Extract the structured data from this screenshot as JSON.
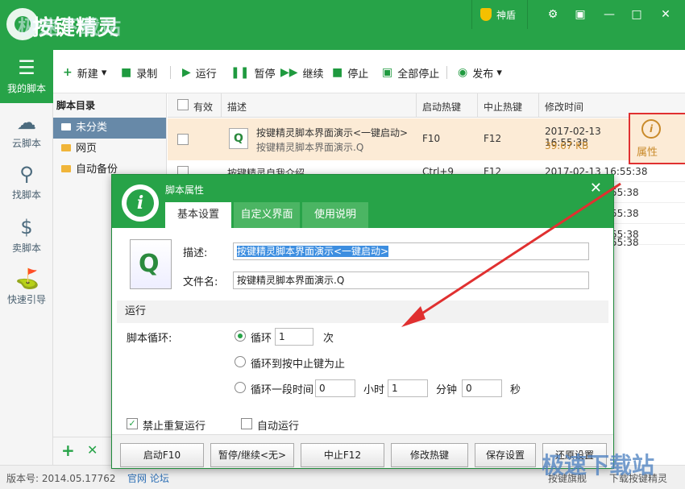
{
  "app": {
    "title": "按键精灵",
    "watermark_top": "极速下载站",
    "shield_label": "神盾"
  },
  "window_controls": {
    "settings": "⚙",
    "skin": "▣",
    "minimize": "—",
    "maximize": "□",
    "close": "✕"
  },
  "leftnav": [
    {
      "label": "我的脚本",
      "icon": "list-icon"
    },
    {
      "label": "云脚本",
      "icon": "cloud-icon"
    },
    {
      "label": "找脚本",
      "icon": "search-icon"
    },
    {
      "label": "卖脚本",
      "icon": "dollar-icon"
    },
    {
      "label": "快速引导",
      "icon": "signpost-icon"
    }
  ],
  "toolbar": {
    "new": "新建",
    "record": "录制",
    "run": "运行",
    "pause": "暂停",
    "resume": "继续",
    "stop": "停止",
    "stop_all": "全部停止",
    "publish": "发布"
  },
  "tree": {
    "header": "脚本目录",
    "items": [
      "未分类",
      "网页",
      "自动备份"
    ]
  },
  "list": {
    "headers": [
      "有效",
      "描述",
      "启动热键",
      "中止热键",
      "修改时间"
    ],
    "rows": [
      {
        "desc": "按键精灵脚本界面演示<一键启动>",
        "file": "按键精灵脚本界面演示.Q",
        "start": "F10",
        "stop": "F12",
        "time": "2017-02-13 16:55:38",
        "size": "39.67 KB"
      },
      {
        "desc": "按键精灵自我介绍",
        "start": "Ctrl+9",
        "stop": "F12",
        "time": "2017-02-13 16:55:38"
      },
      {
        "time": "55:38"
      },
      {
        "time": "55:38"
      },
      {
        "time": "55:38"
      },
      {
        "time": "55:38"
      }
    ],
    "attr_label": "属性"
  },
  "status": {
    "version": "版本号: 2014.05.17762",
    "link": "官网 论坛",
    "btn1": "按键旗舰",
    "btn2": "下载按键精灵"
  },
  "dialog": {
    "title": "脚本属性",
    "tabs": [
      "基本设置",
      "自定义界面",
      "使用说明"
    ],
    "desc_label": "描述:",
    "desc_value": "按键精灵脚本界面演示<一键启动>",
    "file_label": "文件名:",
    "file_value": "按键精灵脚本界面演示.Q",
    "section": "运行",
    "loop_label": "脚本循环:",
    "opt1": "循环",
    "opt1_value": "1",
    "opt1_unit": "次",
    "opt2": "循环到按中止键为止",
    "opt3": "循环一段时间",
    "h_value": "0",
    "h_unit": "小时",
    "m_value": "1",
    "m_unit": "分钟",
    "s_value": "0",
    "s_unit": "秒",
    "no_repeat": "禁止重复运行",
    "auto_run": "自动运行",
    "buttons": [
      "启动F10",
      "暂停/继续<无>",
      "中止F12",
      "修改热键",
      "保存设置",
      "还原设置"
    ]
  },
  "watermark_bottom": "极速下载站"
}
